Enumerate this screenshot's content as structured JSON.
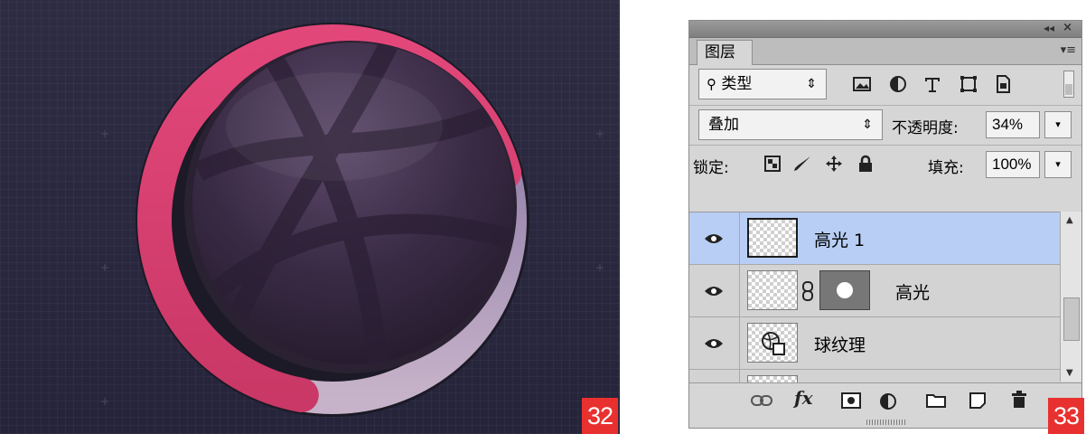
{
  "figures": {
    "left_number": "32",
    "right_number": "33"
  },
  "artwork": {
    "progress_ring": {
      "filled_fraction": 0.68,
      "fill_color": "#d93f73",
      "track_color": "#8a78a8"
    },
    "ball_color": "#3d2e48",
    "background_color": "#2a283d"
  },
  "layers_panel": {
    "title_bar": {
      "collapse_icon": "double-chevron-left-icon",
      "close_icon": "close-icon"
    },
    "tab_label": "图层",
    "filter": {
      "select_value": "类型",
      "icons": [
        "image-filter-icon",
        "adjustment-filter-icon",
        "type-filter-icon",
        "shape-filter-icon",
        "smart-object-filter-icon"
      ]
    },
    "blend": {
      "mode_value": "叠加",
      "opacity_label": "不透明度:",
      "opacity_value": "34%"
    },
    "lock": {
      "label": "锁定:",
      "icons": [
        "lock-transparent-icon",
        "lock-image-icon",
        "lock-position-icon",
        "lock-all-icon"
      ],
      "fill_label": "填充:",
      "fill_value": "100%"
    },
    "layers": [
      {
        "name": "高光 1",
        "visible": true,
        "selected": true,
        "has_mask": false
      },
      {
        "name": "高光",
        "visible": true,
        "selected": false,
        "has_mask": true
      },
      {
        "name": "球纹理",
        "visible": true,
        "selected": false,
        "has_mask": false
      }
    ],
    "bottom_icons": [
      "link-layers-icon",
      "fx-icon",
      "add-mask-icon",
      "adjustment-layer-icon",
      "new-group-icon",
      "new-layer-icon",
      "trash-icon"
    ],
    "fx_label": "fx"
  }
}
